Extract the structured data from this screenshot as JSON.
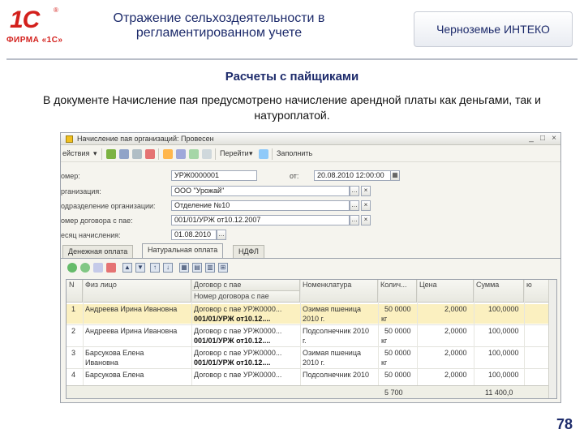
{
  "header": {
    "logo_mark": "1С",
    "logo_reg": "®",
    "logo_text": "ФИРМА «1С»",
    "title": "Отражение сельхоздеятельности в регламентированном учете",
    "company": "Черноземье ИНТЕКО"
  },
  "section": {
    "title": "Расчеты с пайщиками",
    "description": "В документе Начисление пая предусмотрено начисление арендной платы как деньгами, так и натуроплатой."
  },
  "page_number": "78",
  "window": {
    "title": "Начисление пая организаций: Провесен",
    "controls": [
      "_",
      "□",
      "×"
    ],
    "toolbar": {
      "actions_label": "ействия",
      "goto_label": "Перейти",
      "fill_label": "Заполнить"
    },
    "fields": [
      {
        "label": "омер:",
        "value": "УРЖ0000001"
      },
      {
        "label": "рганизация:",
        "value": "ООО \"Урожай\""
      },
      {
        "label": "одразделение организации:",
        "value": "Отделение №10"
      },
      {
        "label": "омер договора с пае:",
        "value": "001/01/УРЖ от10.12.2007"
      },
      {
        "label": "есяц начисления:",
        "value": "01.08.2010"
      }
    ],
    "date_label": "от:",
    "date_value": "20.08.2010 12:00:00",
    "tabs": [
      "Денежная оплата",
      "Натуральная оплата",
      "НДФЛ"
    ],
    "active_tab": 1,
    "grid": {
      "columns": [
        "N",
        "Физ лицо",
        "Договор с пае",
        "Номенклатура",
        "Колич...",
        "Цена",
        "Сумма",
        "ю"
      ],
      "subcolumn": "Номер договора с пае",
      "rows": [
        {
          "n": "1",
          "person": "Андреева Ирина Ивановна",
          "contract": "Договор с пае УРЖ0000...",
          "contract_no": "001/01/УРЖ от10.12....",
          "item": "Озимая пшеница",
          "item2": "2010 г.",
          "qty": "50 0000",
          "unit": "кг",
          "price": "2,0000",
          "sum": "100,0000"
        },
        {
          "n": "2",
          "person": "Андреева Ирина Ивановна",
          "contract": "Договор с пае УРЖ0000...",
          "contract_no": "001/01/УРЖ от10.12....",
          "item": "Подсолнечник 2010",
          "item2": "г.",
          "qty": "50 0000",
          "unit": "кг",
          "price": "2,0000",
          "sum": "100,0000"
        },
        {
          "n": "3",
          "person": "Барсукова Елена",
          "person2": "Ивановна",
          "contract": "Договор с пае УРЖ0000...",
          "contract_no": "001/01/УРЖ от10.12....",
          "item": "Озимая пшеница",
          "item2": "2010 г.",
          "qty": "50 0000",
          "unit": "кг",
          "price": "2,0000",
          "sum": "100,0000"
        },
        {
          "n": "4",
          "person": "Барсукова Елена",
          "contract": "Договор с пае УРЖ0000...",
          "contract_no": "",
          "item": "Подсолнечник 2010",
          "item2": "",
          "qty": "50 0000",
          "unit": "",
          "price": "2,0000",
          "sum": "100,0000"
        }
      ],
      "total_qty": "5 700",
      "total_sum": "11 400,0"
    }
  }
}
